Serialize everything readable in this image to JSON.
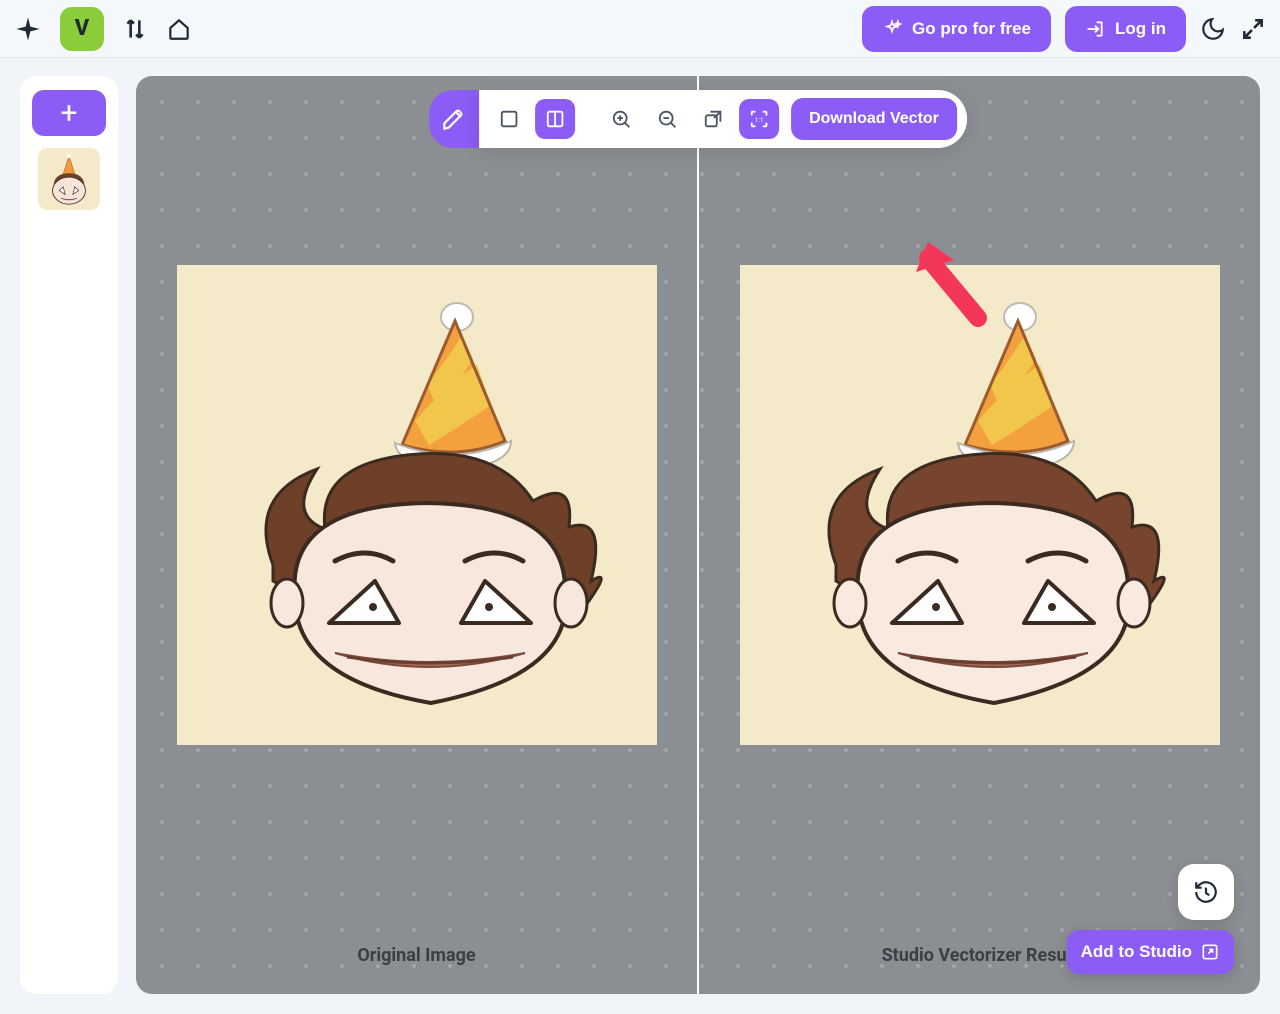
{
  "header": {
    "go_pro_label": "Go pro for free",
    "login_label": "Log in"
  },
  "sidebar": {
    "add_label": "+"
  },
  "toolbar": {
    "download_label": "Download Vector"
  },
  "panes": {
    "left_label": "Original Image",
    "right_label": "Studio Vectorizer Result"
  },
  "footer": {
    "add_to_studio_label": "Add to Studio"
  },
  "colors": {
    "accent": "#8B5CF6",
    "canvas_bg": "#8B8E92",
    "artwork_bg": "#F4E9C9",
    "app_bg": "#F1F4F8",
    "badge_green": "#8ACC3A"
  },
  "icons": {
    "spark": "spark-icon",
    "v_badge": "V",
    "sort": "sort-icon",
    "home": "home-icon",
    "moon": "moon-icon",
    "expand": "expand-icon",
    "pen": "pen-tool-icon",
    "square": "square-icon",
    "split": "split-view-icon",
    "zoom_in": "zoom-in-icon",
    "zoom_out": "zoom-out-icon",
    "popout": "popout-icon",
    "crop": "crop-selection-icon",
    "history": "history-download-icon",
    "open_external": "open-external-icon"
  }
}
